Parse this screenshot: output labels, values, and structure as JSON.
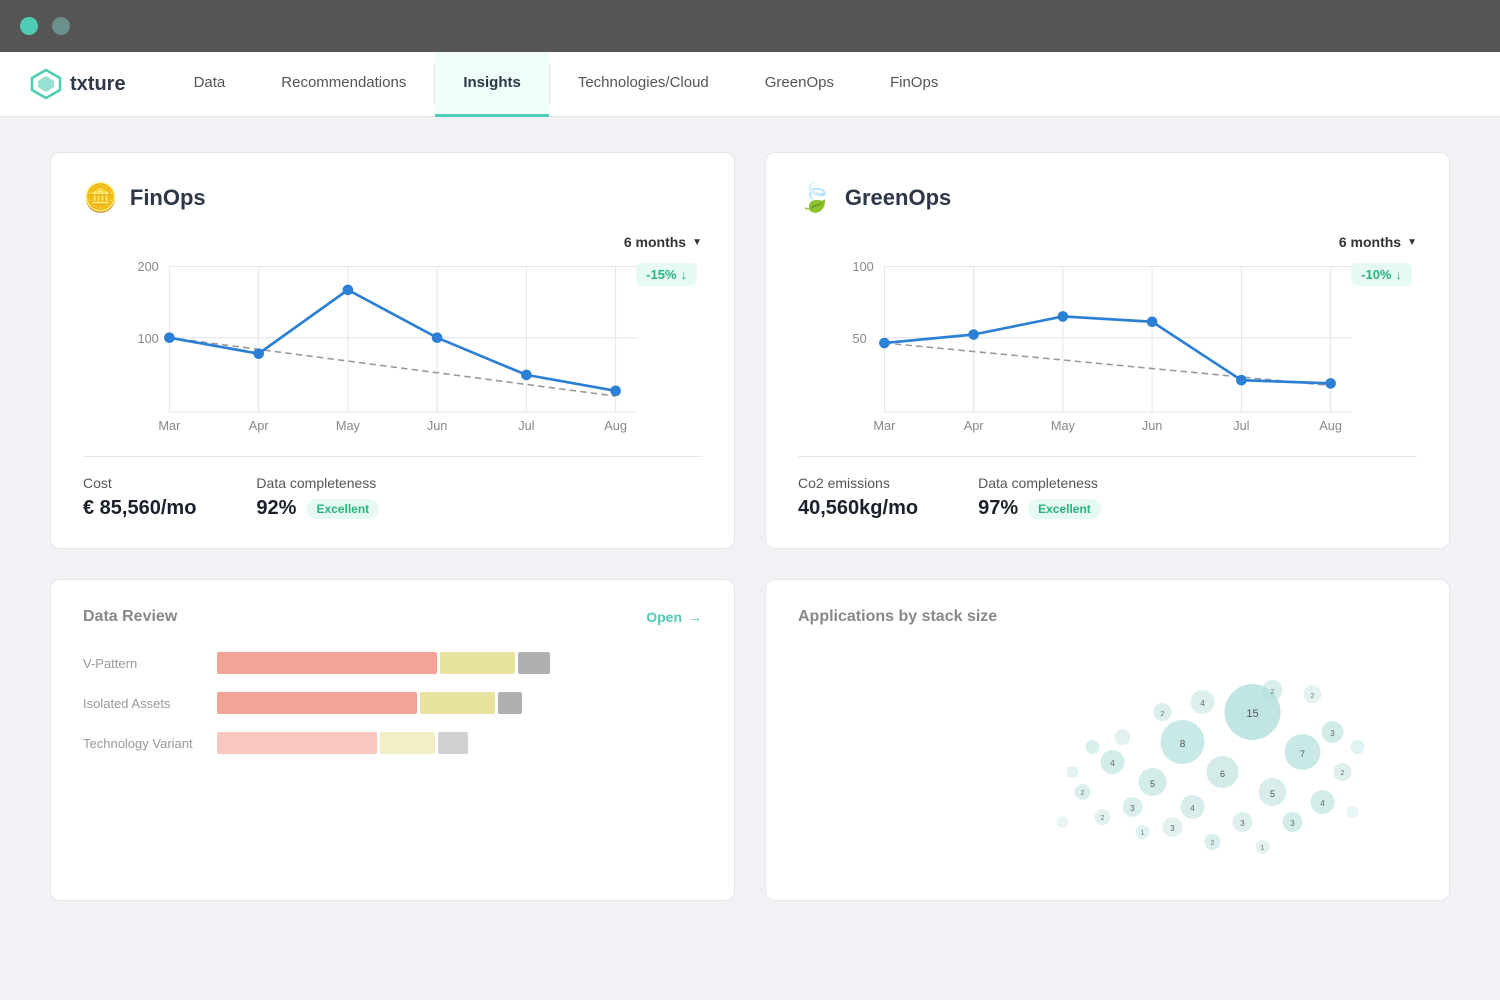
{
  "topbar": {
    "dot1": "green",
    "dot2": "teal"
  },
  "nav": {
    "logo_text": "txture",
    "items": [
      {
        "id": "data",
        "label": "Data",
        "active": false
      },
      {
        "id": "recommendations",
        "label": "Recommendations",
        "active": false
      },
      {
        "id": "insights",
        "label": "Insights",
        "active": true
      },
      {
        "id": "technologies",
        "label": "Technologies/Cloud",
        "active": false
      },
      {
        "id": "greenops",
        "label": "GreenOps",
        "active": false
      },
      {
        "id": "finops",
        "label": "FinOps",
        "active": false
      }
    ]
  },
  "finops_card": {
    "title": "FinOps",
    "time_selector": "6 months",
    "trend_label": "-15%",
    "chart_months": [
      "Mar",
      "Apr",
      "May",
      "Jun",
      "Jul",
      "Aug"
    ],
    "chart_y_labels": [
      "200",
      "100"
    ],
    "cost_label": "Cost",
    "cost_value": "€ 85,560/mo",
    "completeness_label": "Data completeness",
    "completeness_value": "92%",
    "completeness_badge": "Excellent"
  },
  "greenops_card": {
    "title": "GreenOps",
    "time_selector": "6 months",
    "trend_label": "-10%",
    "chart_months": [
      "Mar",
      "Apr",
      "May",
      "Jun",
      "Jul",
      "Aug"
    ],
    "chart_y_labels": [
      "100",
      "50"
    ],
    "emissions_label": "Co2 emissions",
    "emissions_value": "40,560kg/mo",
    "completeness_label": "Data completeness",
    "completeness_value": "97%",
    "completeness_badge": "Excellent"
  },
  "data_review": {
    "title": "Data Review",
    "open_label": "Open",
    "bars": [
      {
        "label": "V-Pattern",
        "red": 55,
        "yellow": 20,
        "gray": 8
      },
      {
        "label": "Isolated Assets",
        "red": 50,
        "yellow": 20,
        "gray": 6
      },
      {
        "label": "Technology Variant",
        "red": 40,
        "yellow": 15,
        "gray": 8
      }
    ]
  },
  "app_stack": {
    "title": "Applications by stack size"
  },
  "colors": {
    "accent": "#4ecdb4",
    "chart_line": "#2b7fd4",
    "chart_dot": "#2b7fd4",
    "trend_positive": "#2bb37e"
  }
}
